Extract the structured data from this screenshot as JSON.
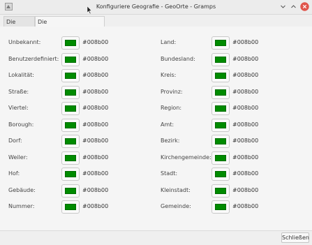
{
  "window": {
    "title": "Konfiguriere Geografie - GeoOrte - Gramps"
  },
  "tabs": [
    {
      "label": "Die Karte"
    },
    {
      "label": "Die Ortemakierungsfarbe"
    }
  ],
  "left_rows": [
    {
      "label": "Unbekannt:",
      "color": "#008b00"
    },
    {
      "label": "Benutzerdefiniert:",
      "color": "#008b00"
    },
    {
      "label": "Lokalität:",
      "color": "#008b00"
    },
    {
      "label": "Straße:",
      "color": "#008b00"
    },
    {
      "label": "Viertel:",
      "color": "#008b00"
    },
    {
      "label": "Borough:",
      "color": "#008b00"
    },
    {
      "label": "Dorf:",
      "color": "#008b00"
    },
    {
      "label": "Weiler:",
      "color": "#008b00"
    },
    {
      "label": "Hof:",
      "color": "#008b00"
    },
    {
      "label": "Gebäude:",
      "color": "#008b00"
    },
    {
      "label": "Nummer:",
      "color": "#008b00"
    }
  ],
  "right_rows": [
    {
      "label": "Land:",
      "color": "#008b00"
    },
    {
      "label": "Bundesland:",
      "color": "#008b00"
    },
    {
      "label": "Kreis:",
      "color": "#008b00"
    },
    {
      "label": "Provinz:",
      "color": "#008b00"
    },
    {
      "label": "Region:",
      "color": "#008b00"
    },
    {
      "label": "Amt:",
      "color": "#008b00"
    },
    {
      "label": "Bezirk:",
      "color": "#008b00"
    },
    {
      "label": "Kirchengemeinde:",
      "color": "#008b00"
    },
    {
      "label": "Stadt:",
      "color": "#008b00"
    },
    {
      "label": "Kleinstadt:",
      "color": "#008b00"
    },
    {
      "label": "Gemeinde:",
      "color": "#008b00"
    }
  ],
  "footer": {
    "close_label": "Schließen"
  },
  "colors": {
    "marker": "#008b00",
    "close_accent": "#e0564c"
  }
}
